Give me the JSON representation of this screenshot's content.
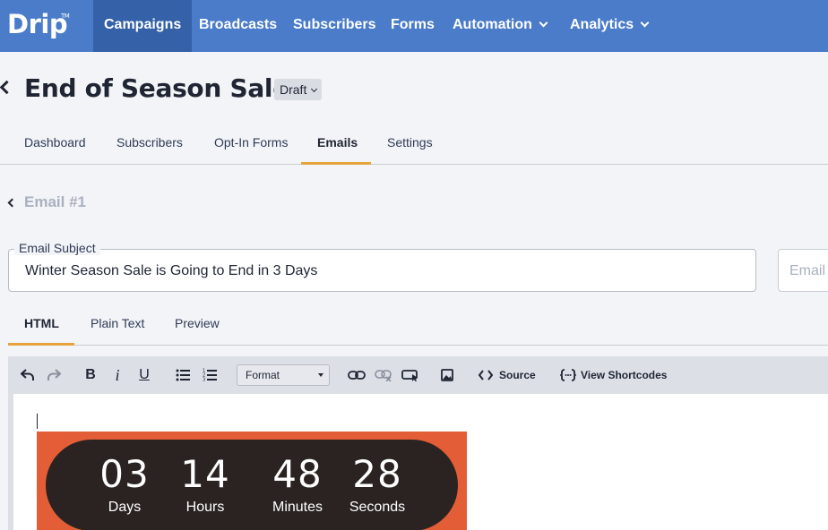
{
  "nav": {
    "logo": "Drip",
    "logo_tm": "TM",
    "items": [
      {
        "label": "Campaigns"
      },
      {
        "label": "Broadcasts"
      },
      {
        "label": "Subscribers"
      },
      {
        "label": "Forms"
      },
      {
        "label": "Automation"
      },
      {
        "label": "Analytics"
      }
    ]
  },
  "page": {
    "title": "End of Season Sale",
    "status": "Draft"
  },
  "subtabs": [
    {
      "label": "Dashboard"
    },
    {
      "label": "Subscribers"
    },
    {
      "label": "Opt-In Forms"
    },
    {
      "label": "Emails"
    },
    {
      "label": "Settings"
    }
  ],
  "email": {
    "title": "Email #1",
    "subject_label": "Email Subject",
    "subject_value": "Winter Season Sale is Going to End in 3 Days",
    "second_field_placeholder": "Email P"
  },
  "editor_tabs": [
    {
      "label": "HTML"
    },
    {
      "label": "Plain Text"
    },
    {
      "label": "Preview"
    }
  ],
  "toolbar": {
    "bold": "B",
    "italic": "i",
    "underline": "U",
    "format": "Format",
    "source": "Source",
    "shortcodes": "View Shortcodes"
  },
  "countdown": {
    "days_value": "03",
    "days_label": "Days",
    "hours_value": "14",
    "hours_label": "Hours",
    "minutes_value": "48",
    "minutes_label": "Minutes",
    "seconds_value": "28",
    "seconds_label": "Seconds"
  },
  "colors": {
    "nav_bg": "#4a7cc9",
    "nav_active": "#3461a8",
    "tab_accent": "#e6a33b",
    "countdown_bg": "#e35e37",
    "countdown_pill": "#2a2321"
  }
}
